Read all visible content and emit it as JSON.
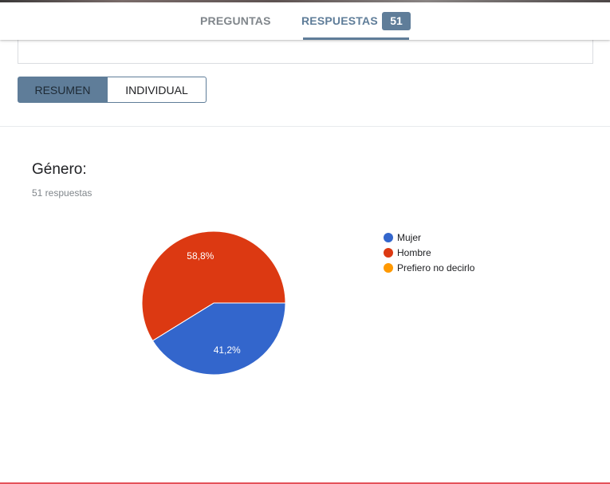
{
  "tabs": {
    "preguntas": "PREGUNTAS",
    "respuestas": "RESPUESTAS",
    "respuestas_count": "51"
  },
  "view_toggle": {
    "resumen": "RESUMEN",
    "individual": "INDIVIDUAL"
  },
  "question": {
    "title": "Género:",
    "responses": "51 respuestas"
  },
  "colors": {
    "accent": "#5f7d99",
    "mujer": "#3366cc",
    "hombre": "#dc3912",
    "prefiero": "#ff9900"
  },
  "chart_data": {
    "type": "pie",
    "categories": [
      "Mujer",
      "Hombre",
      "Prefiero no decirlo"
    ],
    "values": [
      41.2,
      58.8,
      0
    ],
    "data_labels": [
      "41,2%",
      "58,8%",
      ""
    ],
    "colors": [
      "#3366cc",
      "#dc3912",
      "#ff9900"
    ],
    "legend_position": "right"
  }
}
